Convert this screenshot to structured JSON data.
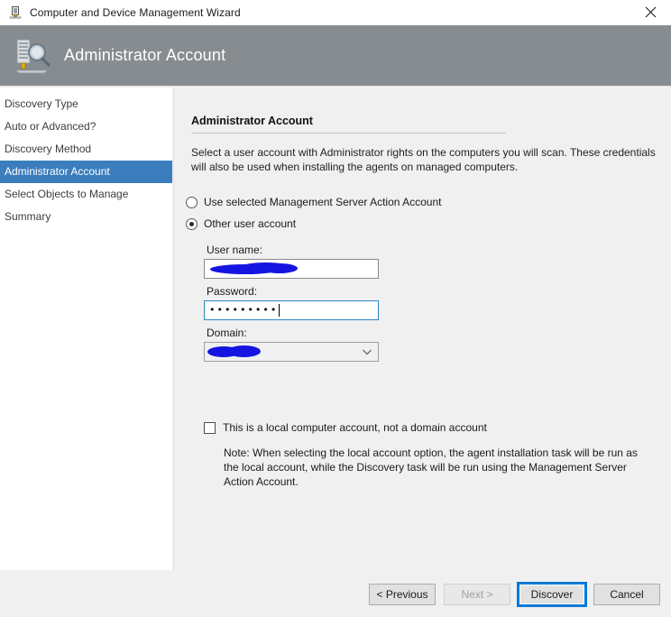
{
  "window": {
    "title": "Computer and Device Management Wizard",
    "icon": "computer-monitor-icon",
    "close_label": "✕"
  },
  "banner": {
    "title": "Administrator Account",
    "icon": "server-search-icon",
    "background": "#878c91"
  },
  "sidebar": {
    "selected_index": 3,
    "selected_color": "#3b7dbd",
    "items": [
      {
        "label": "Discovery Type"
      },
      {
        "label": "Auto or Advanced?"
      },
      {
        "label": "Discovery Method"
      },
      {
        "label": "Administrator Account"
      },
      {
        "label": "Select Objects to Manage"
      },
      {
        "label": "Summary"
      }
    ]
  },
  "content": {
    "section_title": "Administrator Account",
    "description": "Select a user account with Administrator rights on the computers you will scan. These credentials will also be used when installing the agents on managed computers.",
    "radios": [
      {
        "label": "Use selected Management Server Action Account",
        "checked": false
      },
      {
        "label": "Other user account",
        "checked": true
      }
    ],
    "fields": {
      "user_name": {
        "label": "User name:",
        "value": "",
        "redacted": true
      },
      "password": {
        "label": "Password:",
        "value": "•••••••••",
        "focused": true
      },
      "domain": {
        "label": "Domain:",
        "value": "",
        "redacted": true,
        "dropdown_icon": "chevron-down-icon"
      }
    },
    "local_account_checkbox": {
      "label": "This is a local computer account, not a domain account",
      "checked": false
    },
    "note": "Note:  When selecting the local account option, the agent installation task will be run as the local account, while the Discovery task will be run using the Management Server Action Account."
  },
  "footer": {
    "buttons": [
      {
        "label": "< Previous",
        "state": "enabled"
      },
      {
        "label": "Next >",
        "state": "disabled"
      },
      {
        "label": "Discover",
        "state": "focused"
      },
      {
        "label": "Cancel",
        "state": "enabled"
      }
    ]
  }
}
